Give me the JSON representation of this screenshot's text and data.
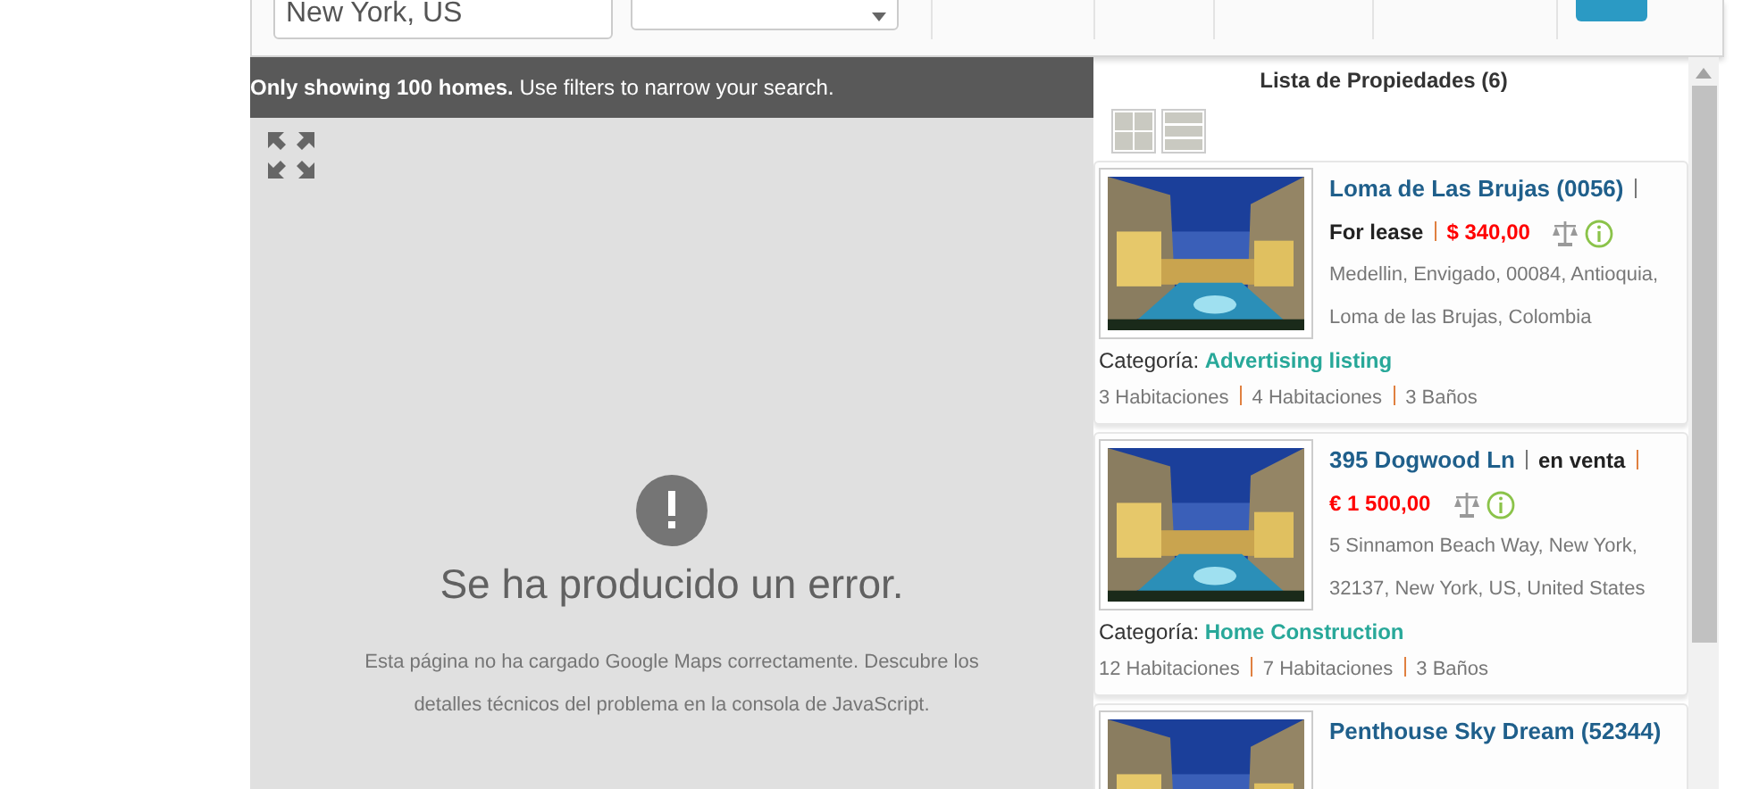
{
  "search": {
    "location": "New York, US"
  },
  "map": {
    "notice": "**Only showing 100 homes.** Use filters to narrow your search.",
    "error_title": "Se ha producido un error.",
    "error_message": "Esta página no ha cargado Google Maps correctamente. Descubre los detalles técnicos del problema en la consola de JavaScript."
  },
  "listing": {
    "title": "Lista de Propiedades (6)",
    "views": [
      {
        "kind": "grid"
      },
      {
        "kind": "list"
      }
    ],
    "properties": [
      {
        "title": "Loma de Las Brujas (0056)",
        "status": "For lease",
        "price": "$ 340,00",
        "address": "Medellin, Envigado, 00084, Antioquia, Loma de las Brujas, Colombia",
        "category_label": "Categoría:",
        "category": "Advertising listing",
        "features": [
          "3 Habitaciones",
          "4 Habitaciones",
          "3 Baños"
        ]
      },
      {
        "title": "395 Dogwood Ln",
        "status": "en venta",
        "price": "€ 1 500,00",
        "address": "5 Sinnamon Beach Way, New York, 32137, New York, US, United States",
        "category_label": "Categoría:",
        "category": "Home Construction",
        "features": [
          "12 Habitaciones",
          "7 Habitaciones",
          "3 Baños"
        ]
      },
      {
        "title": "Penthouse Sky Dream (52344)"
      }
    ]
  }
}
